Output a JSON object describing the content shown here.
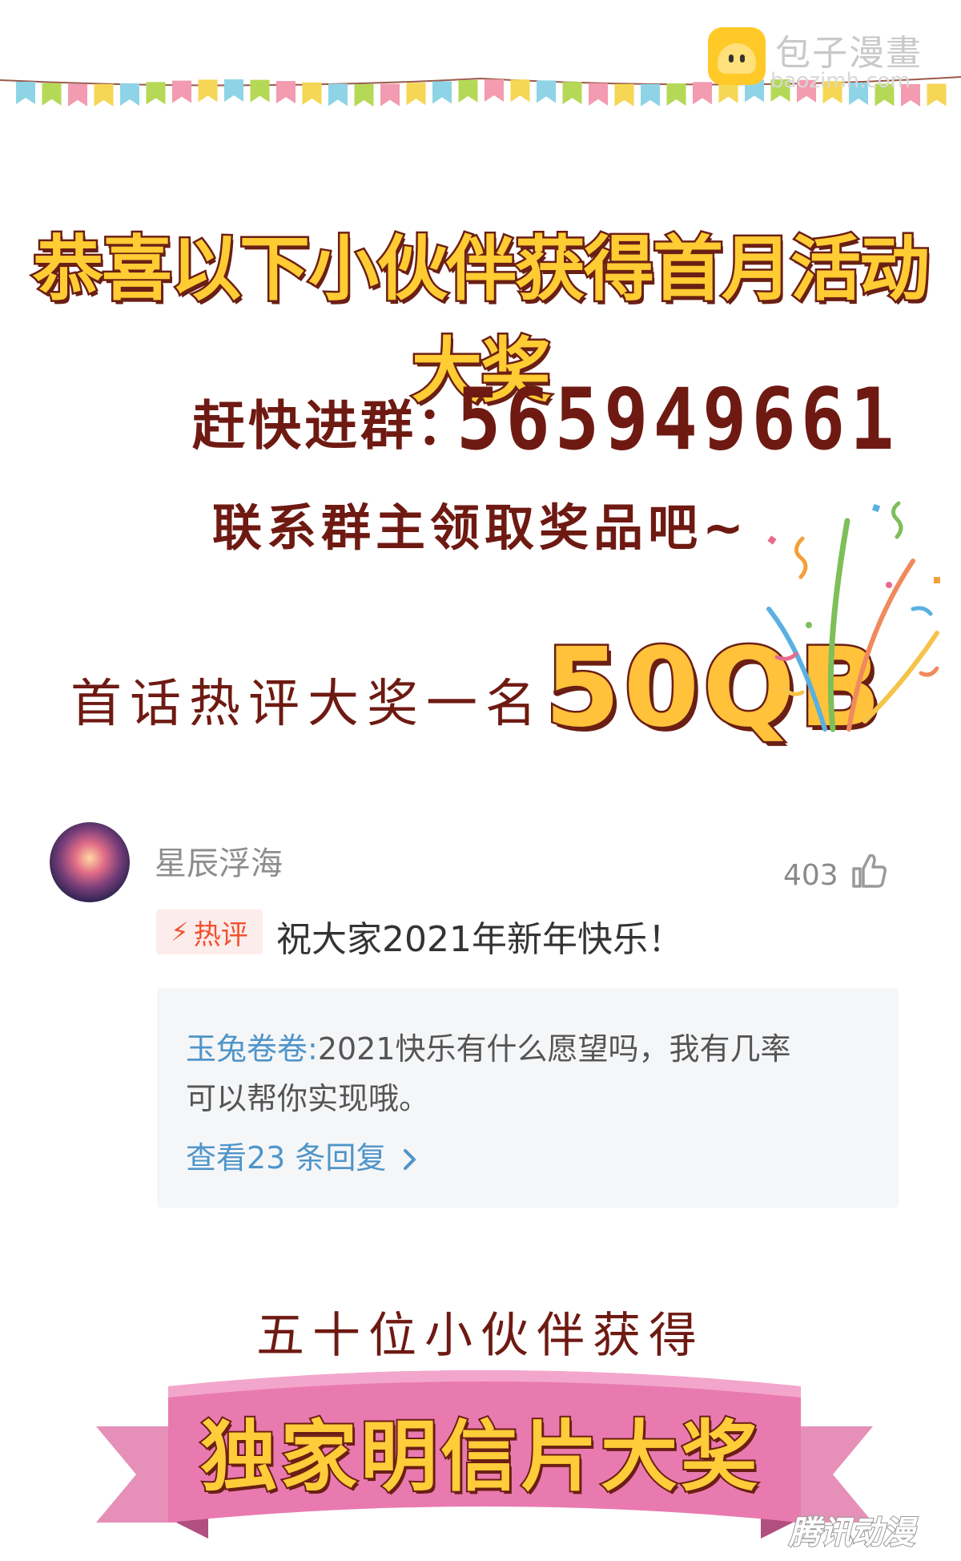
{
  "watermark": {
    "brand": "包子漫畫",
    "url": "baozimh.com"
  },
  "headline": "恭喜以下小伙伴获得首月活动大奖",
  "group": {
    "label": "赶快进群：",
    "number": "565949661"
  },
  "contact_line": "联系群主领取奖品吧~",
  "prize": {
    "label": "首话热评大奖一名：",
    "value": "50QB"
  },
  "comment": {
    "username": "星辰浮海",
    "likes": "403",
    "badge": "热评",
    "text": "祝大家2021年新年快乐！",
    "reply": {
      "user": "玉兔卷卷:",
      "text_line1": "2021快乐有什么愿望吗，我有几率",
      "text_line2": "可以帮你实现哦。"
    },
    "view_replies": "查看23 条回复"
  },
  "second_prize": {
    "label": "五十位小伙伴获得",
    "banner": "独家明信片大奖"
  },
  "corner_logo": "腾讯动漫",
  "colors": {
    "title_fill": "#ffcc33",
    "dark_brown": "#6e1a12",
    "hot_red": "#f0522e",
    "link_blue": "#4f95c9",
    "ribbon_pink": "#e97ab0",
    "bunting": [
      "#8fd4e6",
      "#b5d957",
      "#f39bb0",
      "#f6d655"
    ]
  }
}
